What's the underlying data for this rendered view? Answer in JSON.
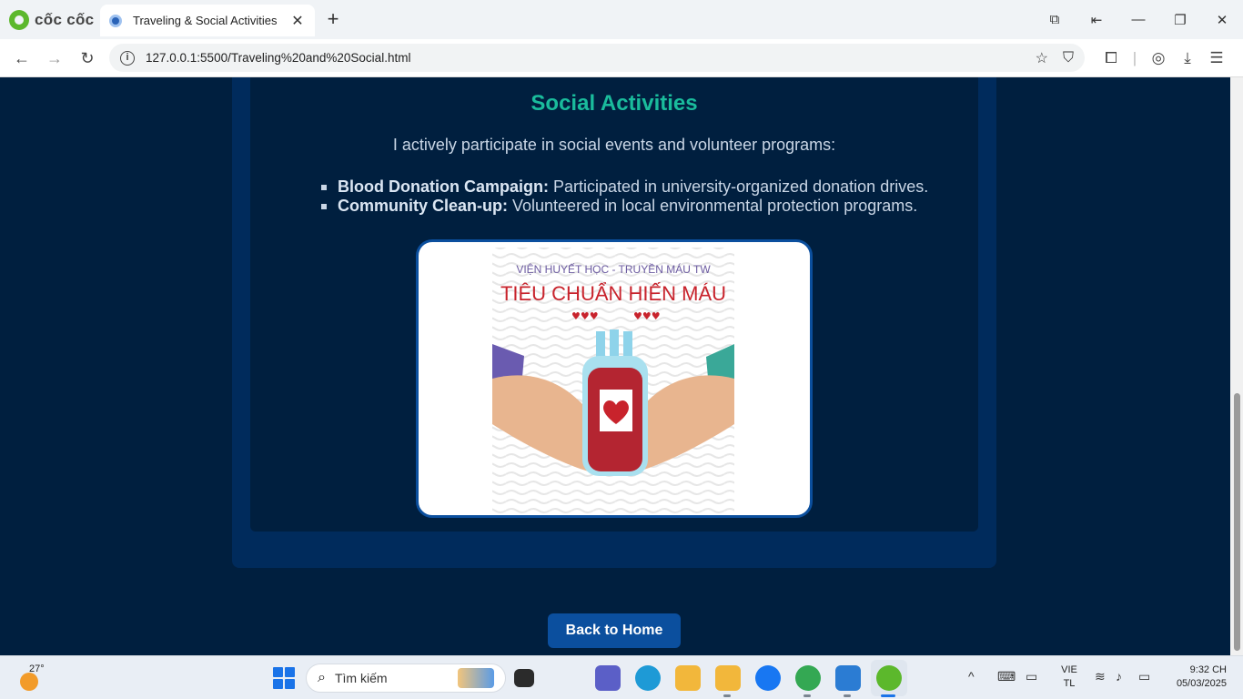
{
  "browser": {
    "brand": "cốc cốc",
    "tab_title": "Traveling & Social Activities",
    "url": "127.0.0.1:5500/Traveling%20and%20Social.html"
  },
  "page": {
    "section_title": "Social Activities",
    "intro": "I actively participate in social events and volunteer programs:",
    "items": [
      {
        "title": "Blood Donation Campaign:",
        "text": " Participated in university-organized donation drives."
      },
      {
        "title": "Community Clean-up:",
        "text": " Volunteered in local environmental protection programs."
      }
    ],
    "poster": {
      "line1": "VIỆN HUYẾT HỌC - TRUYỀN MÁU TW",
      "line2": "TIÊU CHUẨN HIẾN MÁU"
    },
    "home_button": "Back to Home"
  },
  "taskbar": {
    "weather_temp": "27°",
    "search_placeholder": "Tìm kiếm",
    "lang_line1": "VIE",
    "lang_line2": "TL",
    "time": "9:32 CH",
    "date": "05/03/2025"
  },
  "colors": {
    "page_bg": "#001f3f",
    "card_bg": "#002b5c",
    "accent": "#1abc9c",
    "button": "#0b4f9e"
  }
}
